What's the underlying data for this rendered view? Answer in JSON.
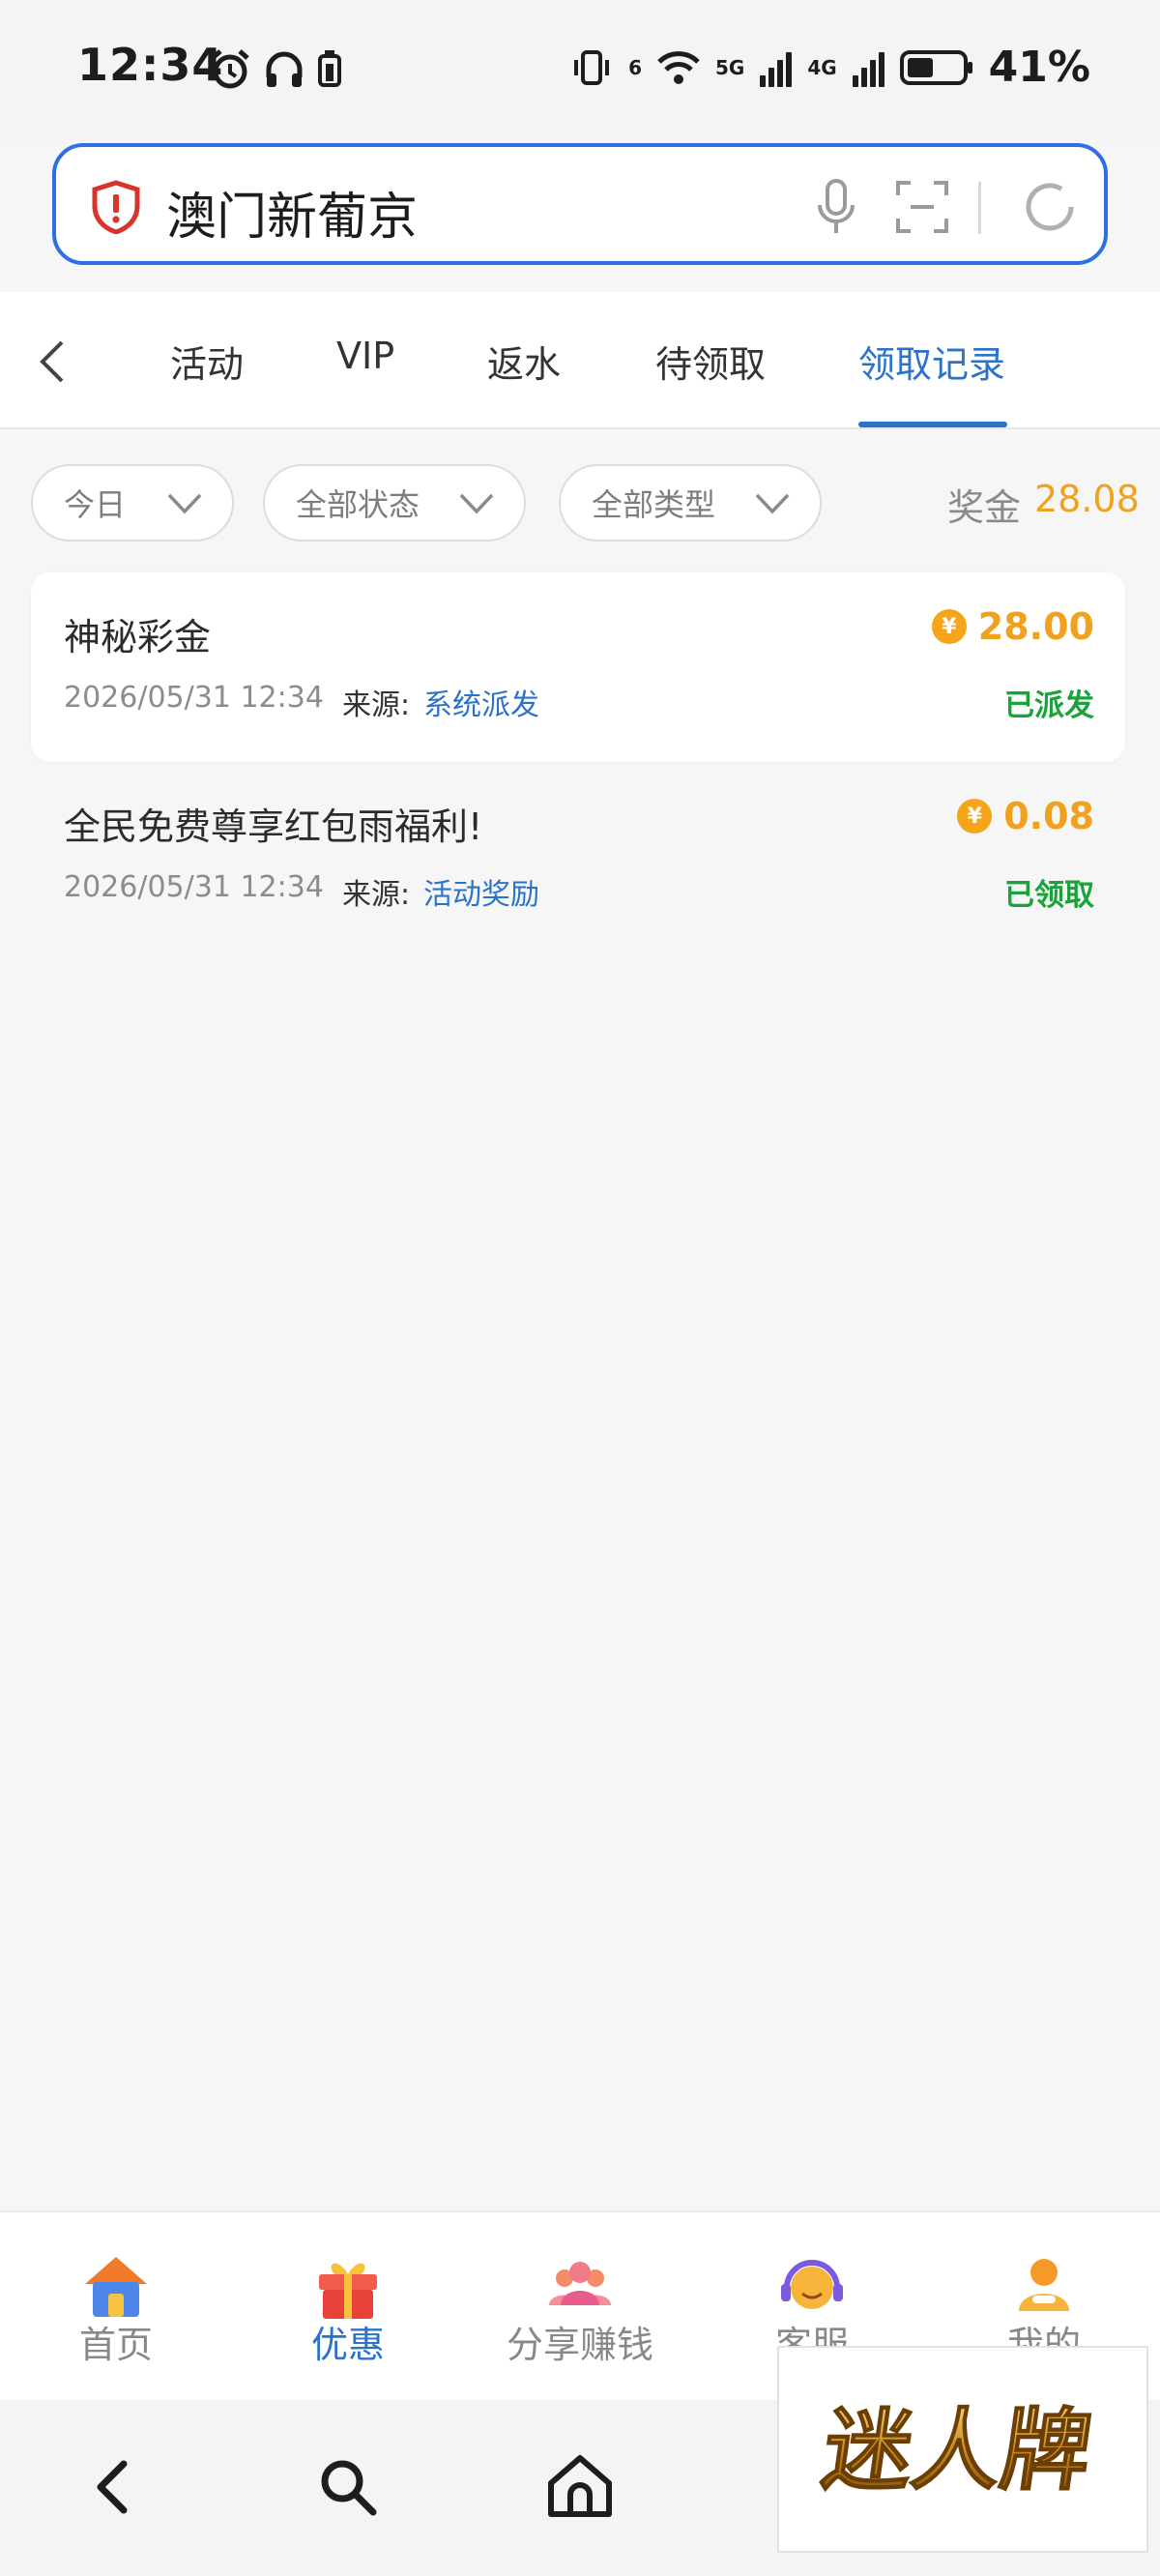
{
  "status_bar": {
    "time": "12:34",
    "battery_percent": "41%",
    "network_labels": [
      "6",
      "5G",
      "4G"
    ],
    "icons": [
      "alarm-icon",
      "headphones-icon",
      "watch-icon",
      "vibrate-icon",
      "wifi-icon",
      "signal-icon",
      "battery-icon"
    ]
  },
  "search": {
    "query": "澳门新葡京",
    "icons": [
      "shield-alert-icon",
      "mic-icon",
      "scan-icon",
      "refresh-icon"
    ]
  },
  "tabs": {
    "items": [
      {
        "label": "活动"
      },
      {
        "label": "VIP"
      },
      {
        "label": "返水"
      },
      {
        "label": "待领取"
      },
      {
        "label": "领取记录"
      }
    ],
    "active_index": 4
  },
  "filters": {
    "date": "今日",
    "status": "全部状态",
    "type": "全部类型",
    "bonus_label": "奖金",
    "bonus_value": "28.08"
  },
  "records": [
    {
      "title": "神秘彩金",
      "date": "2026/05/31 12:34",
      "source_label": "来源:",
      "source": "系统派发",
      "amount": "28.00",
      "status": "已派发"
    },
    {
      "title": "全民免费尊享红包雨福利!",
      "date": "2026/05/31 12:34",
      "source_label": "来源:",
      "source": "活动奖励",
      "amount": "0.08",
      "status": "已领取"
    }
  ],
  "app_nav": {
    "items": [
      {
        "label": "首页",
        "icon": "home-icon"
      },
      {
        "label": "优惠",
        "icon": "gift-icon"
      },
      {
        "label": "分享赚钱",
        "icon": "people-icon"
      },
      {
        "label": "客服",
        "icon": "support-icon"
      },
      {
        "label": "我的",
        "icon": "profile-icon"
      }
    ],
    "active_index": 1
  },
  "coin_symbol": "¥",
  "watermark_text": "迷人牌",
  "colors": {
    "accent": "#2b72c9",
    "search_border": "#2f6fe4",
    "amount": "#f0a21e",
    "status_success": "#19a33a",
    "background": "#f6f6f7"
  }
}
